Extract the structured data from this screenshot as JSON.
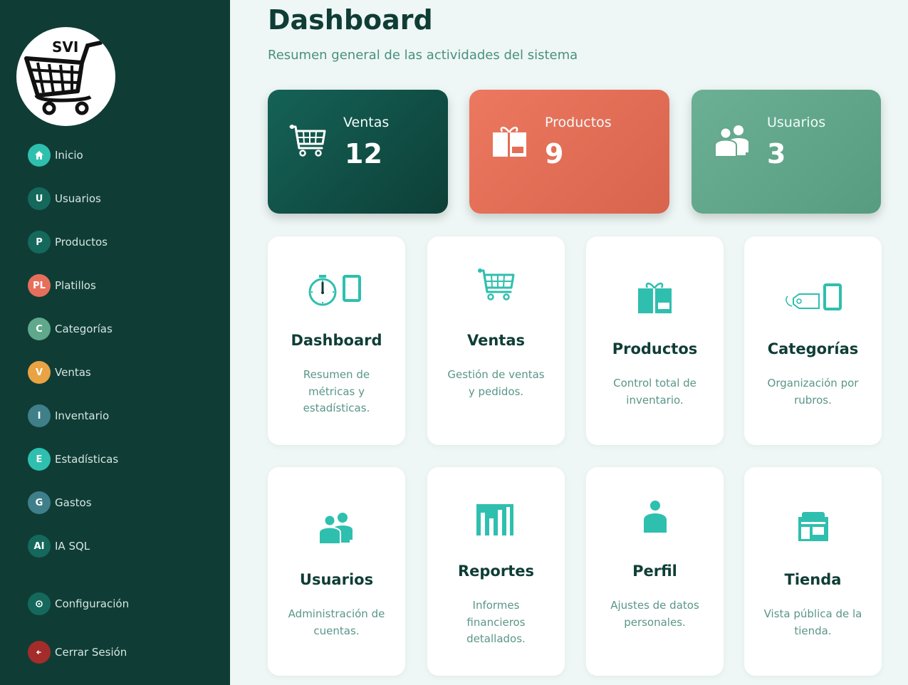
{
  "brand": {
    "logo_text": "SVI"
  },
  "sidebar": {
    "items": [
      {
        "badge": "",
        "label": "Inicio",
        "color": "#2fbfae",
        "icon": "home-icon"
      },
      {
        "badge": "U",
        "label": "Usuarios",
        "color": "#15695c"
      },
      {
        "badge": "P",
        "label": "Productos",
        "color": "#15695c"
      },
      {
        "badge": "PL",
        "label": "Platillos",
        "color": "#e66f5c"
      },
      {
        "badge": "C",
        "label": "Categorías",
        "color": "#5fa88c"
      },
      {
        "badge": "V",
        "label": "Ventas",
        "color": "#e9a343"
      },
      {
        "badge": "I",
        "label": "Inventario",
        "color": "#3f7f8a"
      },
      {
        "badge": "E",
        "label": "Estadísticas",
        "color": "#2fbfae"
      },
      {
        "badge": "G",
        "label": "Gastos",
        "color": "#3f7f8a"
      },
      {
        "badge": "AI",
        "label": "IA SQL",
        "color": "#15695c"
      }
    ],
    "settings": {
      "label": "Configuración",
      "color": "#15695c",
      "icon": "gear-icon"
    },
    "logout": {
      "label": "Cerrar Sesión",
      "color": "#a42c2a",
      "icon": "logout-icon"
    }
  },
  "header": {
    "title": "Dashboard",
    "subtitle": "Resumen general de las actividades del sistema"
  },
  "stats": [
    {
      "label": "Ventas",
      "value": "12",
      "icon": "cart-icon"
    },
    {
      "label": "Productos",
      "value": "9",
      "icon": "gift-box-icon"
    },
    {
      "label": "Usuarios",
      "value": "3",
      "icon": "users-icon"
    }
  ],
  "cards": [
    {
      "title": "Dashboard",
      "desc": "Resumen de métricas y estadísticas.",
      "icon": "stopwatch-tablet-icon"
    },
    {
      "title": "Ventas",
      "desc": "Gestión de ventas y pedidos.",
      "icon": "cart-icon"
    },
    {
      "title": "Productos",
      "desc": "Control total de inventario.",
      "icon": "gift-box-icon"
    },
    {
      "title": "Categorías",
      "desc": "Organización por rubros.",
      "icon": "tag-tablet-icon"
    },
    {
      "title": "Usuarios",
      "desc": "Administración de cuentas.",
      "icon": "users-icon"
    },
    {
      "title": "Reportes",
      "desc": "Informes financieros detallados.",
      "icon": "bar-chart-icon"
    },
    {
      "title": "Perfil",
      "desc": "Ajustes de datos personales.",
      "icon": "person-icon"
    },
    {
      "title": "Tienda",
      "desc": "Vista pública de la tienda.",
      "icon": "store-icon"
    }
  ],
  "colors": {
    "sidebar_bg": "#0f3d36",
    "accent": "#2fbfae",
    "page_bg": "#eef7f5"
  }
}
